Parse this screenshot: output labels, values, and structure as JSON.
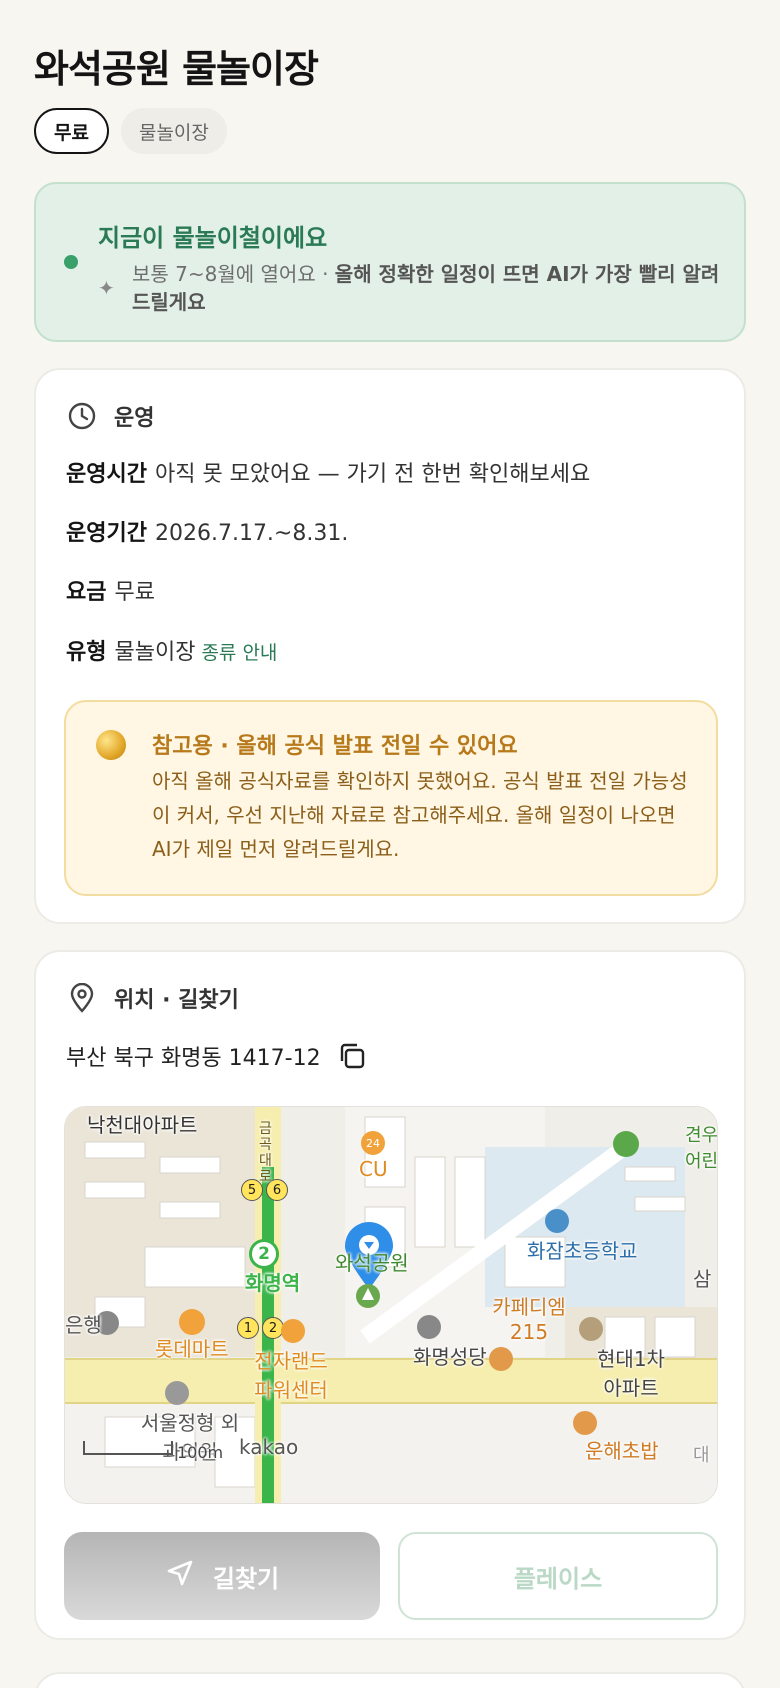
{
  "page": {
    "title": "와석공원 물놀이장",
    "chips": [
      "무료",
      "물놀이장"
    ]
  },
  "season": {
    "title": "지금이 물놀이철이에요",
    "desc_plain": "보통 7~8월에 열어요 · ",
    "desc_bold": "올해 정확한 일정이 뜨면 AI가 가장 빨리 알려드릴게요"
  },
  "operation": {
    "header": "운영",
    "hours_label": "운영시간",
    "hours_value": "아직 못 모았어요 — 가기 전 한번 확인해보세요",
    "period_label": "운영기간",
    "period_value": "2026.7.17.~8.31.",
    "fee_label": "요금",
    "fee_value": "무료",
    "type_label": "유형",
    "type_value": "물놀이장",
    "type_link": "종류 안내",
    "notice_title": "참고용 · 올해 공식 발표 전일 수 있어요",
    "notice_desc": "아직 올해 공식자료를 확인하지 못했어요. 공식 발표 전일 가능성이 커서, 우선 지난해 자료로 참고해주세요. 올해 일정이 나오면 AI가 제일 먼저 알려드릴게요."
  },
  "location": {
    "header": "위치 · 길찾기",
    "address": "부산 북구 화명동 1417-12",
    "map_labels": {
      "apt1": "낙천대아파트",
      "cu": "CU",
      "school": "화잠초등학교",
      "park": "와석공원",
      "station": "화명역",
      "cafe": "카페디엠 215",
      "church": "화명성당",
      "apt2": "현대1차 아파트",
      "mart": "롯데마트",
      "electro": "전자랜드 파워센터",
      "clinic": "서울정형 외과의원",
      "bank": "은행",
      "restaurant": "운해초밥",
      "road": "금곡대로",
      "scale": "100m",
      "brand": "kakao",
      "edge1": "견우 어린",
      "edge2": "삼",
      "edge3": "대"
    },
    "route_button": "길찾기",
    "places_button": "플레이스"
  }
}
